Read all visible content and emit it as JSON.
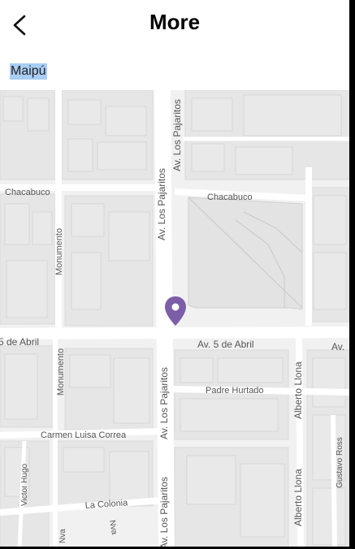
{
  "header": {
    "title": "More",
    "back_icon": "chevron-left-icon"
  },
  "location": {
    "label": "Maipú"
  },
  "map": {
    "marker_icon": "map-pin-icon",
    "marker_color": "#7b5ea7",
    "streets": {
      "chacabuco_left": "Chacabuco",
      "chacabuco_right": "Chacabuco",
      "monumento_top": "Monumento",
      "monumento_bottom": "Monumento",
      "pajaritos_top": "Av. Los Pajaritos",
      "pajaritos_middle": "Av. Los Pajaritos",
      "pajaritos_lower": "Av. Los Pajaritos",
      "pajaritos_bottom": "Av. Los Pajaritos",
      "cinco_abril_left": "5 de Abril",
      "cinco_abril_center": "Av. 5 de Abril",
      "cinco_abril_right": "Av.",
      "padre_hurtado": "Padre Hurtado",
      "alberto_llona_top": "Alberto Llona",
      "alberto_llona_bottom": "Alberto Llona",
      "carmen_luisa_correa": "Carmen Luisa Correa",
      "victor_hugo": "Victor Hugo",
      "la_colonia": "La Colonia",
      "gustavo_ross": "Gustavo Ross",
      "nva_1": "Nva",
      "nva_2": "Nva"
    }
  }
}
